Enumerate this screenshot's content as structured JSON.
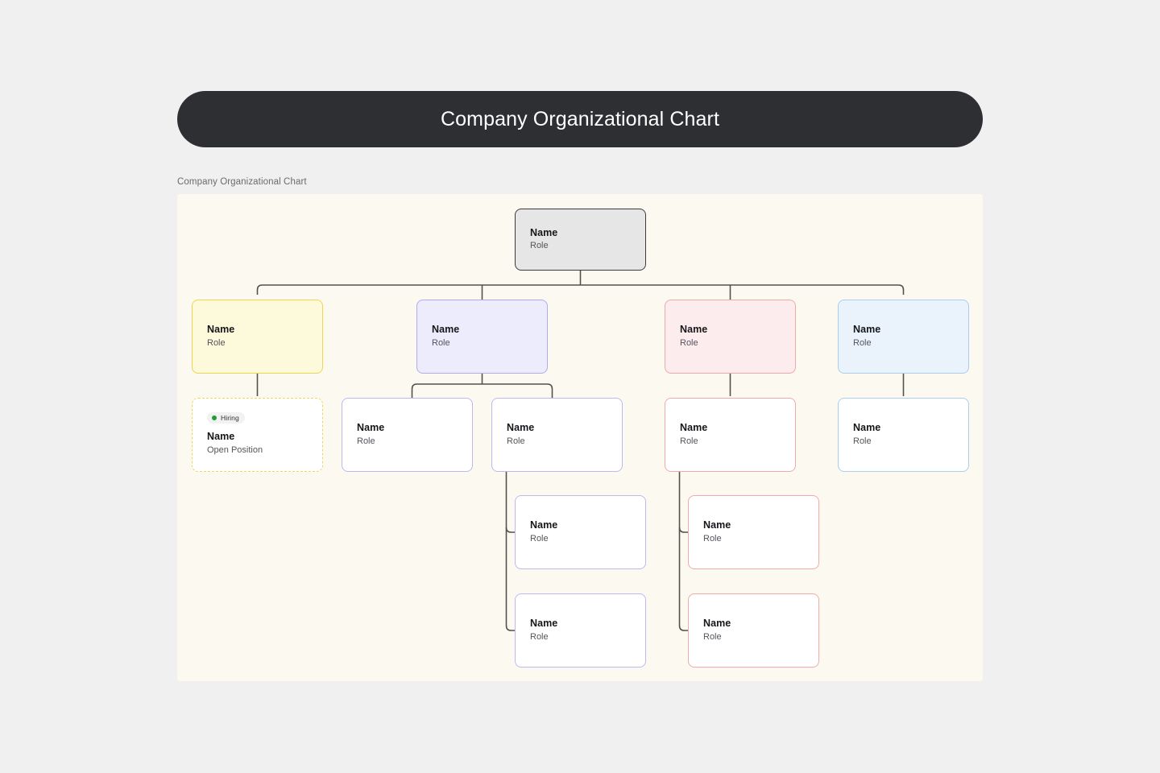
{
  "header": {
    "title": "Company Organizational Chart"
  },
  "caption": "Company Organizational Chart",
  "chart_data": {
    "type": "diagram",
    "title": "Company Organizational Chart",
    "diagram_kind": "organizational-chart",
    "orientation": "top-down",
    "canvas_background": "#fcfaf0",
    "connector_color": "#53514c",
    "levels": 4,
    "node_count": 14,
    "nodes": [
      {
        "id": "root",
        "level": 1,
        "name": "Name",
        "role": "Role",
        "fill": "#e6e6e6",
        "border": "#3b3b3b",
        "style": "solid",
        "parent": null
      },
      {
        "id": "yellow",
        "level": 2,
        "name": "Name",
        "role": "Role",
        "fill": "#fdf9db",
        "border": "#f2d34e",
        "style": "solid",
        "parent": "root"
      },
      {
        "id": "purple",
        "level": 2,
        "name": "Name",
        "role": "Role",
        "fill": "#edecfc",
        "border": "#b0aaf0",
        "style": "solid",
        "parent": "root"
      },
      {
        "id": "pink",
        "level": 2,
        "name": "Name",
        "role": "Role",
        "fill": "#fdeced",
        "border": "#f0a8a8",
        "style": "solid",
        "parent": "root"
      },
      {
        "id": "blue",
        "level": 2,
        "name": "Name",
        "role": "Role",
        "fill": "#eaf3fc",
        "border": "#a9cdee",
        "style": "solid",
        "parent": "root"
      },
      {
        "id": "open",
        "level": 3,
        "name": "Name",
        "role": "Open Position",
        "badge": "Hiring",
        "badge_dot_color": "#1f9d36",
        "fill": "#ffffff",
        "border": "#f0d45c",
        "style": "dashed",
        "parent": "yellow"
      },
      {
        "id": "purple-a",
        "level": 3,
        "name": "Name",
        "role": "Role",
        "fill": "#ffffff",
        "border": "#bdb8ef",
        "style": "solid",
        "parent": "purple"
      },
      {
        "id": "purple-b",
        "level": 3,
        "name": "Name",
        "role": "Role",
        "fill": "#ffffff",
        "border": "#bdb8ef",
        "style": "solid",
        "parent": "purple"
      },
      {
        "id": "pink-a",
        "level": 3,
        "name": "Name",
        "role": "Role",
        "fill": "#ffffff",
        "border": "#f2a9a9",
        "style": "solid",
        "parent": "pink"
      },
      {
        "id": "blue-a",
        "level": 3,
        "name": "Name",
        "role": "Role",
        "fill": "#ffffff",
        "border": "#aacfee",
        "style": "solid",
        "parent": "blue"
      },
      {
        "id": "purple-b1",
        "level": 4,
        "name": "Name",
        "role": "Role",
        "fill": "#ffffff",
        "border": "#bdb8ef",
        "style": "solid",
        "parent": "purple-b"
      },
      {
        "id": "purple-b2",
        "level": 4,
        "name": "Name",
        "role": "Role",
        "fill": "#ffffff",
        "border": "#bdb8ef",
        "style": "solid",
        "parent": "purple-b"
      },
      {
        "id": "pink-a1",
        "level": 4,
        "name": "Name",
        "role": "Role",
        "fill": "#ffffff",
        "border": "#f2a9a9",
        "style": "solid",
        "parent": "pink-a"
      },
      {
        "id": "pink-a2",
        "level": 4,
        "name": "Name",
        "role": "Role",
        "fill": "#ffffff",
        "border": "#f2a9a9",
        "style": "solid",
        "parent": "pink-a"
      }
    ]
  }
}
